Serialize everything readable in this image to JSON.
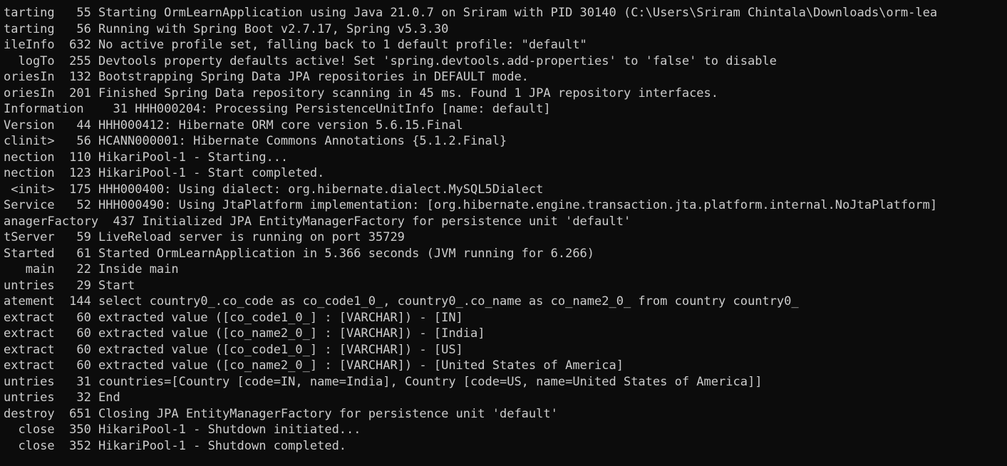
{
  "terminal": {
    "background": "#0c0c0c",
    "foreground": "#cccccc",
    "lines": [
      "tarting   55 Starting OrmLearnApplication using Java 21.0.7 on Sriram with PID 30140 (C:\\Users\\Sriram Chintala\\Downloads\\orm-lea",
      "tarting   56 Running with Spring Boot v2.7.17, Spring v5.3.30",
      "ileInfo  632 No active profile set, falling back to 1 default profile: \"default\"",
      "  logTo  255 Devtools property defaults active! Set 'spring.devtools.add-properties' to 'false' to disable",
      "oriesIn  132 Bootstrapping Spring Data JPA repositories in DEFAULT mode.",
      "oriesIn  201 Finished Spring Data repository scanning in 45 ms. Found 1 JPA repository interfaces.",
      "Information    31 HHH000204: Processing PersistenceUnitInfo [name: default]",
      "Version   44 HHH000412: Hibernate ORM core version 5.6.15.Final",
      "clinit>   56 HCANN000001: Hibernate Commons Annotations {5.1.2.Final}",
      "nection  110 HikariPool-1 - Starting...",
      "nection  123 HikariPool-1 - Start completed.",
      " <init>  175 HHH000400: Using dialect: org.hibernate.dialect.MySQL5Dialect",
      "Service   52 HHH000490: Using JtaPlatform implementation: [org.hibernate.engine.transaction.jta.platform.internal.NoJtaPlatform]",
      "anagerFactory  437 Initialized JPA EntityManagerFactory for persistence unit 'default'",
      "tServer   59 LiveReload server is running on port 35729",
      "Started   61 Started OrmLearnApplication in 5.366 seconds (JVM running for 6.266)",
      "   main   22 Inside main",
      "untries   29 Start",
      "atement  144 select country0_.co_code as co_code1_0_, country0_.co_name as co_name2_0_ from country country0_",
      "extract   60 extracted value ([co_code1_0_] : [VARCHAR]) - [IN]",
      "extract   60 extracted value ([co_name2_0_] : [VARCHAR]) - [India]",
      "extract   60 extracted value ([co_code1_0_] : [VARCHAR]) - [US]",
      "extract   60 extracted value ([co_name2_0_] : [VARCHAR]) - [United States of America]",
      "untries   31 countries=[Country [code=IN, name=India], Country [code=US, name=United States of America]]",
      "untries   32 End",
      "destroy  651 Closing JPA EntityManagerFactory for persistence unit 'default'",
      "  close  350 HikariPool-1 - Shutdown initiated...",
      "  close  352 HikariPool-1 - Shutdown completed."
    ]
  }
}
